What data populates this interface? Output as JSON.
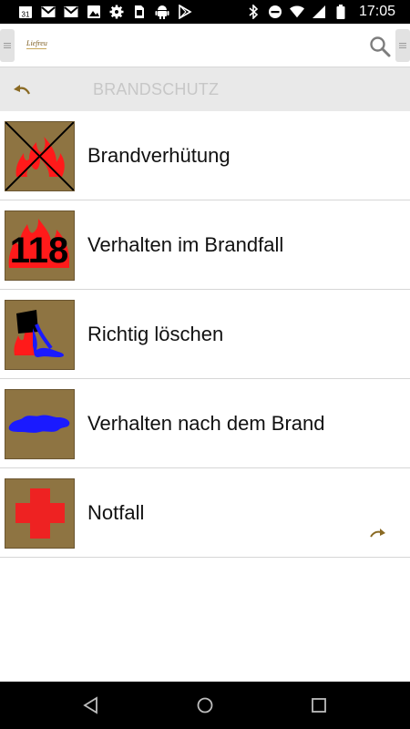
{
  "status_bar": {
    "time": "17:05",
    "calendar_day": "31",
    "left_icons": [
      "calendar-icon",
      "gmail-icon",
      "gmail-icon",
      "photo-icon",
      "settings-icon",
      "sim-icon",
      "android-icon",
      "play-store-icon"
    ],
    "right_icons": [
      "bluetooth-icon",
      "do-not-disturb-icon",
      "wifi-icon",
      "signal-icon",
      "battery-icon"
    ]
  },
  "toolbar": {
    "logo_text": "Liefreu"
  },
  "section": {
    "title": "BRANDSCHUTZ"
  },
  "colors": {
    "thumb_bg": "#8e7442",
    "accent_brown": "#8a6a24",
    "flame_red": "#ff1a1a",
    "water_blue": "#1a1aff",
    "cross_red": "#ee2222"
  },
  "items": [
    {
      "label": "Brandverhütung",
      "icon": "no-fire-icon"
    },
    {
      "label": "Verhalten im Brandfall",
      "icon": "emergency-118-icon",
      "icon_text": "118"
    },
    {
      "label": "Richtig löschen",
      "icon": "extinguish-icon"
    },
    {
      "label": "Verhalten nach dem Brand",
      "icon": "water-puddle-icon"
    },
    {
      "label": "Notfall",
      "icon": "first-aid-cross-icon"
    }
  ],
  "nav_bar": {
    "buttons": [
      "back-icon",
      "home-icon",
      "recents-icon"
    ]
  }
}
